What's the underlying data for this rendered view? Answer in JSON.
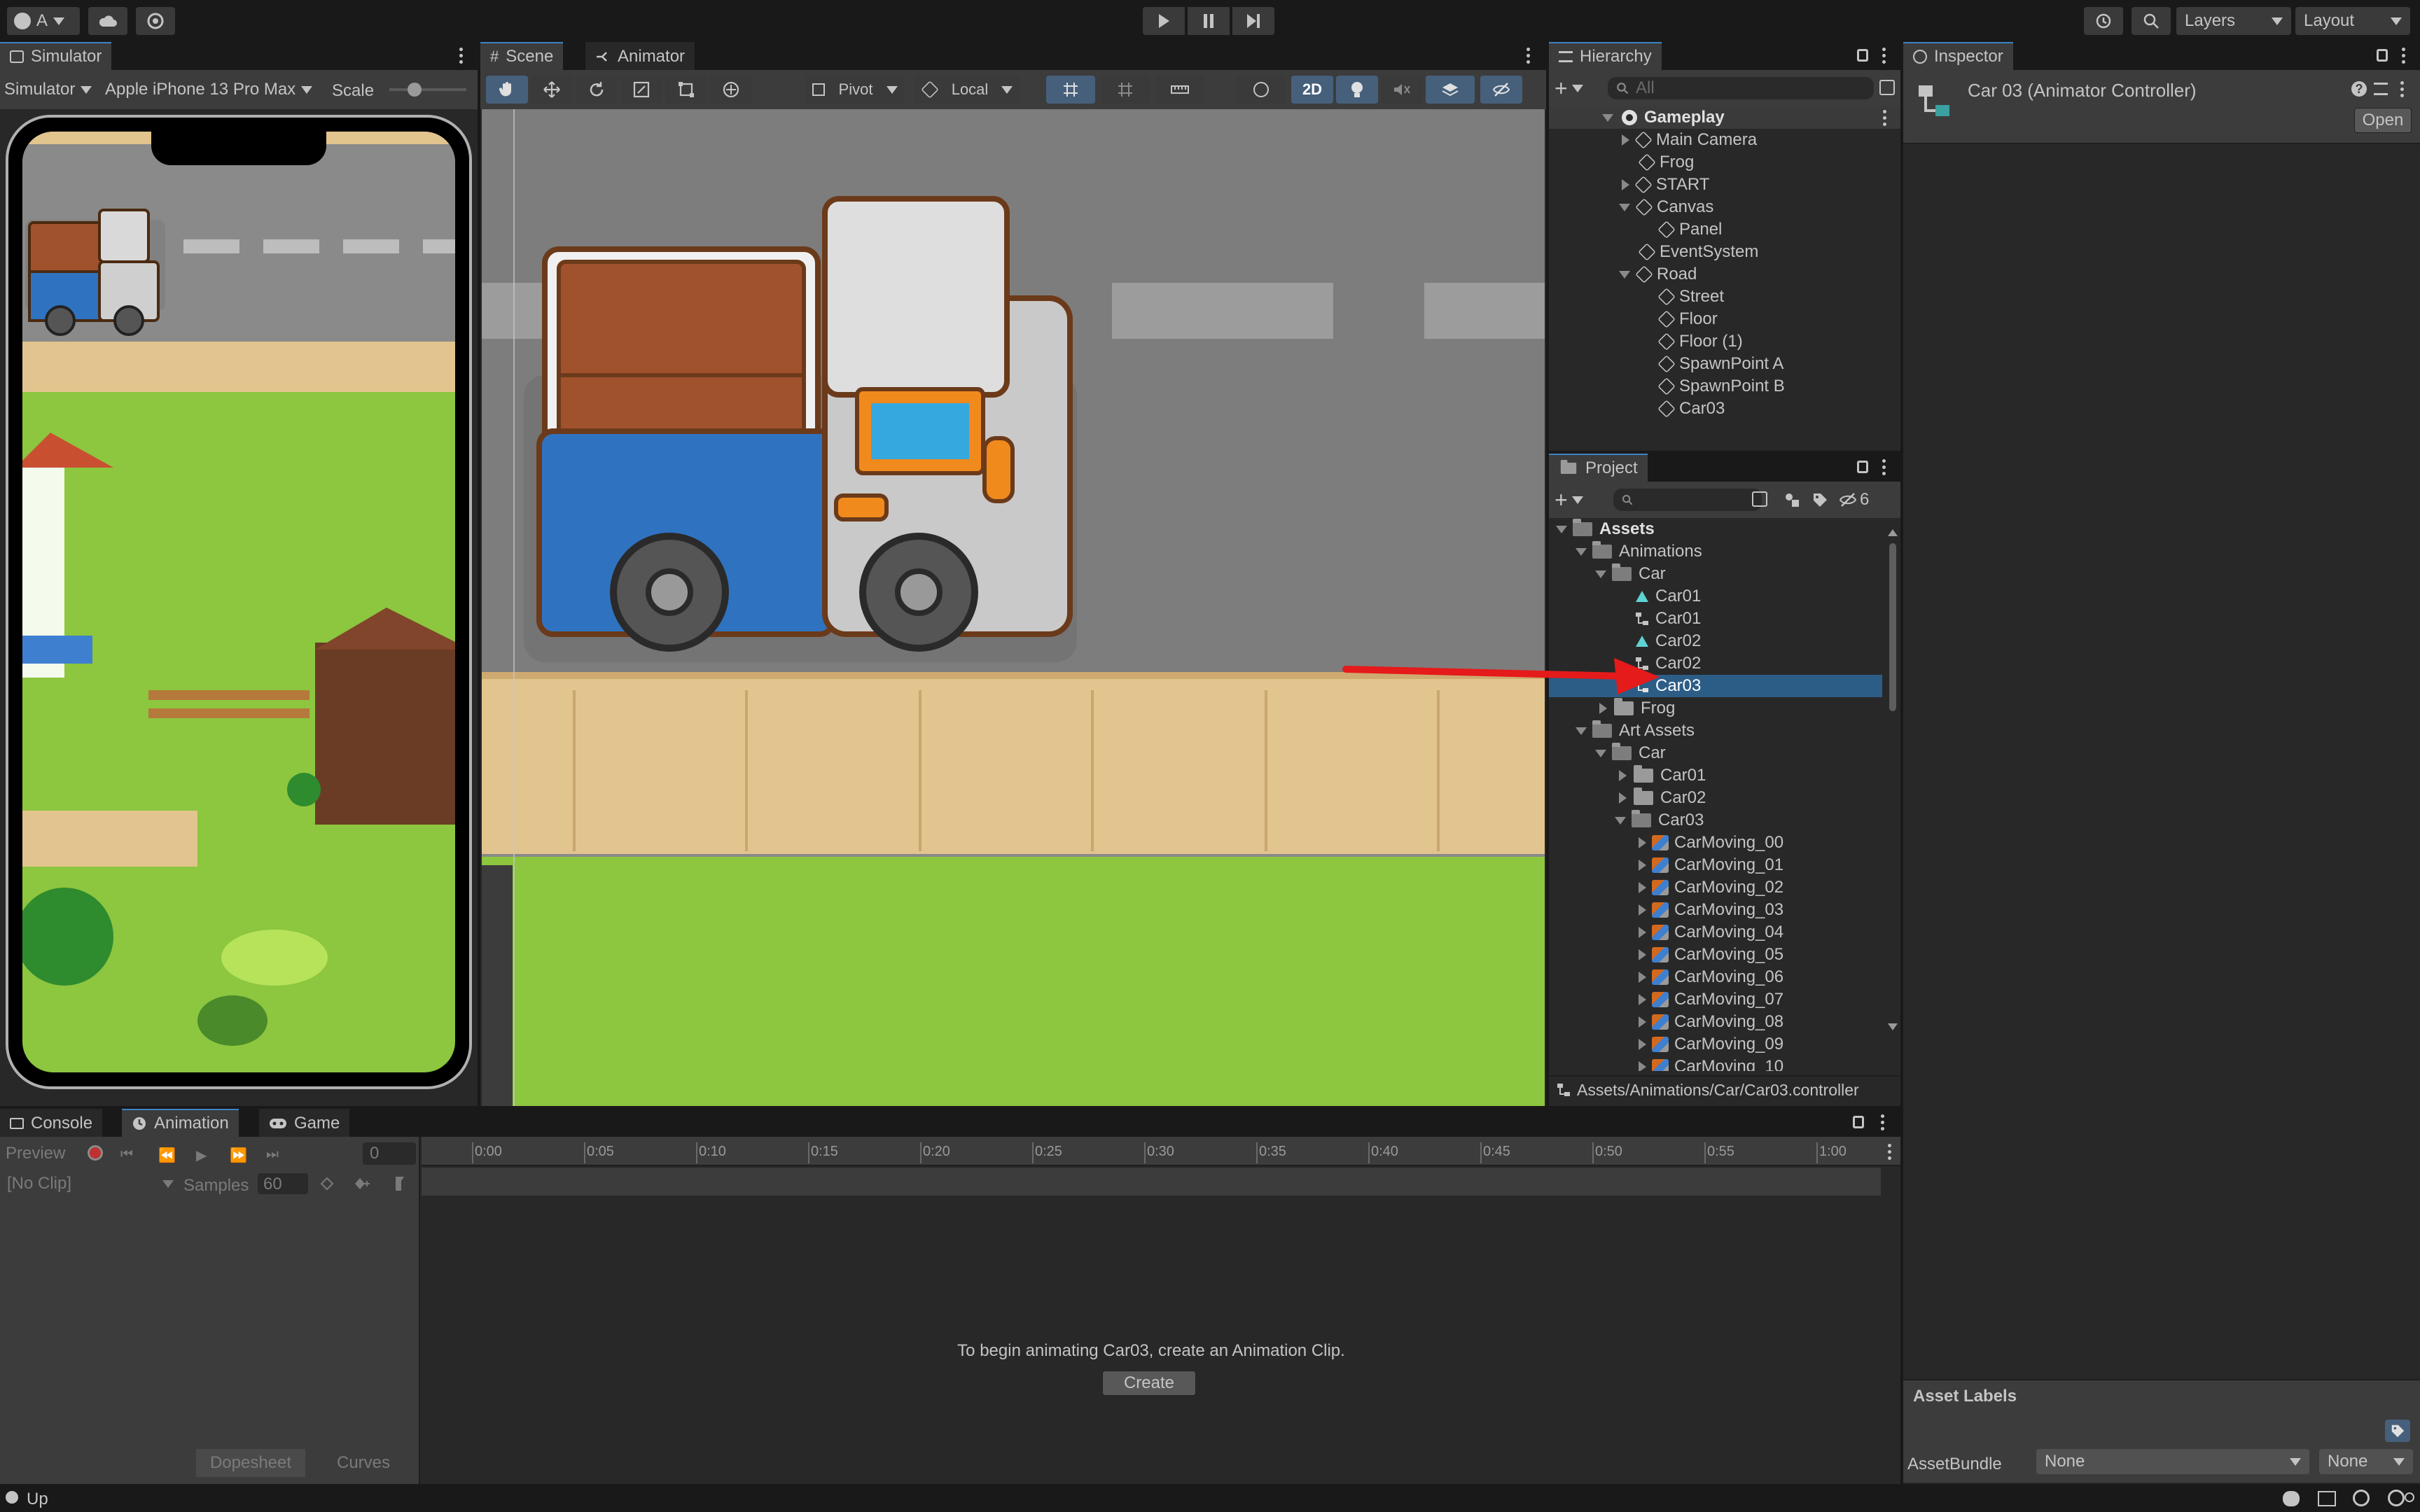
{
  "toolbar": {
    "account": "A",
    "layers": "Layers",
    "layout": "Layout"
  },
  "simulator": {
    "tab": "Simulator",
    "mode": "Simulator",
    "device": "Apple iPhone 13 Pro Max",
    "scale_label": "Scale"
  },
  "scene": {
    "tab_scene": "Scene",
    "tab_animator": "Animator",
    "pivot": "Pivot",
    "local": "Local",
    "twod": "2D"
  },
  "hierarchy": {
    "tab": "Hierarchy",
    "search_placeholder": "All",
    "scene_name": "Gameplay",
    "items": [
      {
        "label": "Main Camera"
      },
      {
        "label": "Frog"
      },
      {
        "label": "START"
      },
      {
        "label": "Canvas"
      },
      {
        "label": "Panel"
      },
      {
        "label": "EventSystem"
      },
      {
        "label": "Road"
      },
      {
        "label": "Street"
      },
      {
        "label": "Floor"
      },
      {
        "label": "Floor (1)"
      },
      {
        "label": "SpawnPoint A"
      },
      {
        "label": "SpawnPoint B"
      },
      {
        "label": "Car03"
      }
    ]
  },
  "project": {
    "tab": "Project",
    "hidden_count": "6",
    "path": "Assets/Animations/Car/Car03.controller",
    "items": [
      {
        "label": "Assets"
      },
      {
        "label": "Animations"
      },
      {
        "label": "Car"
      },
      {
        "label": "Car01"
      },
      {
        "label": "Car01"
      },
      {
        "label": "Car02"
      },
      {
        "label": "Car02"
      },
      {
        "label": "Car03"
      },
      {
        "label": "Frog"
      },
      {
        "label": "Art Assets"
      },
      {
        "label": "Car"
      },
      {
        "label": "Car01"
      },
      {
        "label": "Car02"
      },
      {
        "label": "Car03"
      },
      {
        "label": "CarMoving_00"
      },
      {
        "label": "CarMoving_01"
      },
      {
        "label": "CarMoving_02"
      },
      {
        "label": "CarMoving_03"
      },
      {
        "label": "CarMoving_04"
      },
      {
        "label": "CarMoving_05"
      },
      {
        "label": "CarMoving_06"
      },
      {
        "label": "CarMoving_07"
      },
      {
        "label": "CarMoving_08"
      },
      {
        "label": "CarMoving_09"
      },
      {
        "label": "CarMoving_10"
      }
    ]
  },
  "inspector": {
    "tab": "Inspector",
    "title": "Car 03 (Animator Controller)",
    "open": "Open",
    "asset_labels": "Asset Labels",
    "assetbundle_label": "AssetBundle",
    "assetbundle_value": "None",
    "variant_value": "None"
  },
  "animation": {
    "tab_console": "Console",
    "tab_animation": "Animation",
    "tab_game": "Game",
    "preview": "Preview",
    "frame": "0",
    "clip": "[No Clip]",
    "samples_label": "Samples",
    "samples_value": "60",
    "ticks": [
      "0:00",
      "0:05",
      "0:10",
      "0:15",
      "0:20",
      "0:25",
      "0:30",
      "0:35",
      "0:40",
      "0:45",
      "0:50",
      "0:55",
      "1:00"
    ],
    "message": "To begin animating Car03, create an Animation Clip.",
    "create": "Create",
    "dopesheet": "Dopesheet",
    "curves": "Curves"
  },
  "status": {
    "text": "Up"
  },
  "colors": {
    "accent": "#3d85c6",
    "selection": "#2c5d87",
    "annotation": "#e51a1a"
  }
}
